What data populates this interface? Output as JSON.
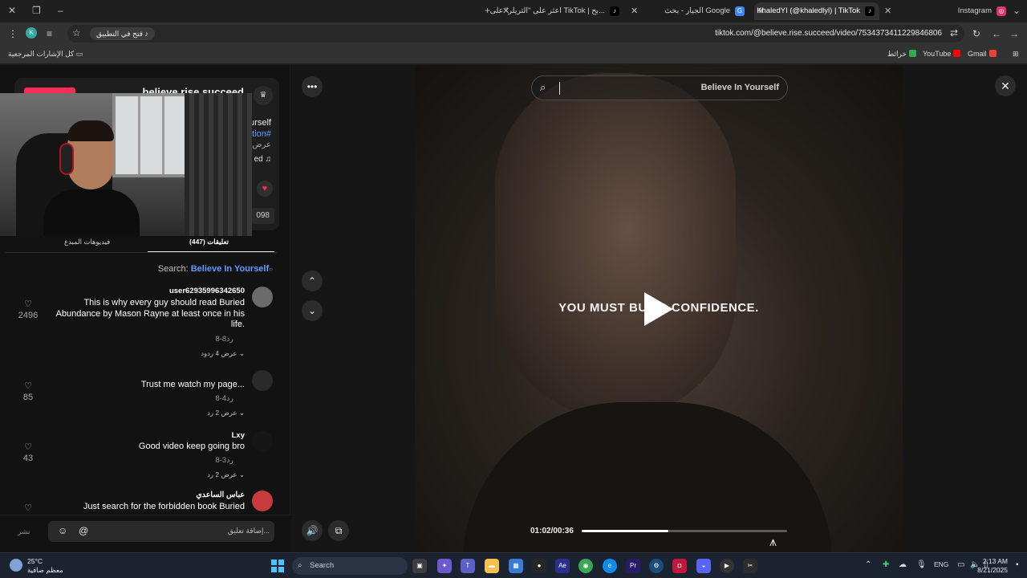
{
  "tabs": [
    {
      "title": "Instagram",
      "icon": "instagram-icon",
      "color": "#e1306c"
    },
    {
      "title": "KhaledYI (@khaledlyl) | TikTok",
      "icon": "tiktok-icon",
      "active": true
    },
    {
      "title": "الجيار - بحث Google",
      "icon": "google-icon",
      "color": "#4285f4"
    },
    {
      "title": "اعثر على \"التريلر\" على TikTok | بح...",
      "icon": "tiktok-icon"
    }
  ],
  "address_bar": {
    "url": "tiktok.com/@believe.rise.succeed/video/7534373411229846806",
    "open_app_label": "فتح في التطبيق",
    "profile_initial": "K"
  },
  "bookmarks": {
    "all_bookmarks_label": "كل الإشارات المرجعية",
    "items": [
      {
        "label": "Gmail",
        "color": "#ea4335"
      },
      {
        "label": "YouTube",
        "color": "#ff0000"
      },
      {
        "label": "خرائط",
        "color": "#34a853"
      }
    ]
  },
  "author": {
    "name": "believe.rise.succeed",
    "desc_line1": "yourself",
    "hashtag": "ation#",
    "desc_line3": "عرض",
    "music": "ed ♫",
    "misc": "s",
    "count": "098"
  },
  "panel_tabs": {
    "comments": "تعليقات (447)",
    "creator_videos": "فيديوهات المبدع"
  },
  "search_bar": {
    "prefix": "Search:",
    "term": "Believe In Yourself"
  },
  "comments": [
    {
      "user": "user62935996342650",
      "text": "This is why every guy should read Buried Abundance by Mason Rayne at least once in his life.",
      "date": "8-8",
      "reply": "رد",
      "replies": "عرض 4 ردود",
      "likes": "2496",
      "avatar_color": "#6b6b6b"
    },
    {
      "user": "",
      "text": "Trust me watch my page...",
      "date": "8-4",
      "reply": "رد",
      "replies": "عرض 2 رد",
      "likes": "85",
      "avatar_color": "#2a2a2a"
    },
    {
      "user": "Lxy",
      "text": "Good video keep going bro",
      "date": "8-3",
      "reply": "رد",
      "replies": "عرض 2 رد",
      "likes": "43",
      "avatar_color": "#161616"
    },
    {
      "user": "عباس الساعدي",
      "text": "Just search for the forbidden book Buried",
      "date": "",
      "reply": "",
      "replies": "",
      "likes": "",
      "avatar_color": "#c63b3b"
    }
  ],
  "comment_bar": {
    "placeholder": "إضافة تعليق...",
    "post_label": "نشر"
  },
  "video": {
    "search_term": "Believe In Yourself",
    "caption": "YOU MUST BUILD CONFIDENCE.",
    "time": "01:02/00:36",
    "progress": 0.42
  },
  "taskbar": {
    "weather_temp": "25°C",
    "weather_desc": "معظم صافية",
    "search_label": "Search",
    "lang": "ENG",
    "time": "2:13 AM",
    "date": "8/21/2025",
    "apps": [
      {
        "name": "file-explorer-icon",
        "color": "#f2c14e"
      },
      {
        "name": "store-icon",
        "color": "#3a7bd5"
      },
      {
        "name": "after-effects-icon",
        "color": "#2a2e8f",
        "label": "Ae"
      },
      {
        "name": "chrome-icon",
        "color": "#3aa757"
      },
      {
        "name": "edge-icon",
        "color": "#0f8ce9"
      },
      {
        "name": "premiere-icon",
        "color": "#2b1b67",
        "label": "Pr"
      },
      {
        "name": "steam-icon",
        "color": "#1b4c7a"
      },
      {
        "name": "app-icon",
        "color": "#c0183a"
      },
      {
        "name": "discord-icon",
        "color": "#5865f2"
      }
    ]
  }
}
